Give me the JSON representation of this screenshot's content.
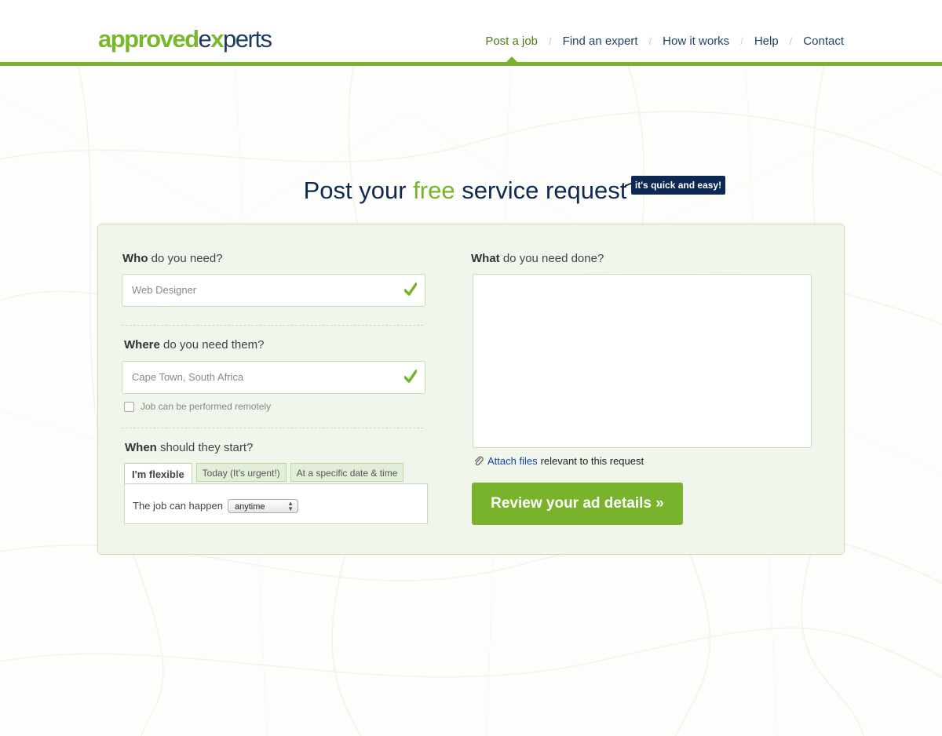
{
  "logo": {
    "part1": "approved",
    "part2": "e",
    "part3": "x",
    "part4": "perts"
  },
  "nav": {
    "items": [
      {
        "label": "Post a job",
        "active": true
      },
      {
        "label": "Find an expert"
      },
      {
        "label": "How it works"
      },
      {
        "label": "Help"
      },
      {
        "label": "Contact"
      }
    ]
  },
  "title": {
    "before": "Post your ",
    "highlight": "free",
    "after": " service request",
    "tag": "it's quick and easy!"
  },
  "who": {
    "label_bold": "Who",
    "label_rest": " do you need?",
    "value": "Web Designer"
  },
  "where": {
    "label_bold": "Where",
    "label_rest": " do you need them?",
    "value": "Cape Town, South Africa",
    "remote_label": "Job can be performed remotely"
  },
  "when": {
    "label_bold": "When",
    "label_rest": " should they start?",
    "tabs": [
      "I'm flexible",
      "Today (It's urgent!)",
      "At a specific date & time"
    ],
    "happen_label": "The job can happen",
    "select_value": "anytime"
  },
  "what": {
    "label_bold": "What",
    "label_rest": " do you need done?",
    "attach_link": "Attach files",
    "attach_rest": "relevant to this request"
  },
  "review_button": "Review your ad details »",
  "colors": {
    "accent": "#79b32b",
    "navy": "#0d2853"
  }
}
